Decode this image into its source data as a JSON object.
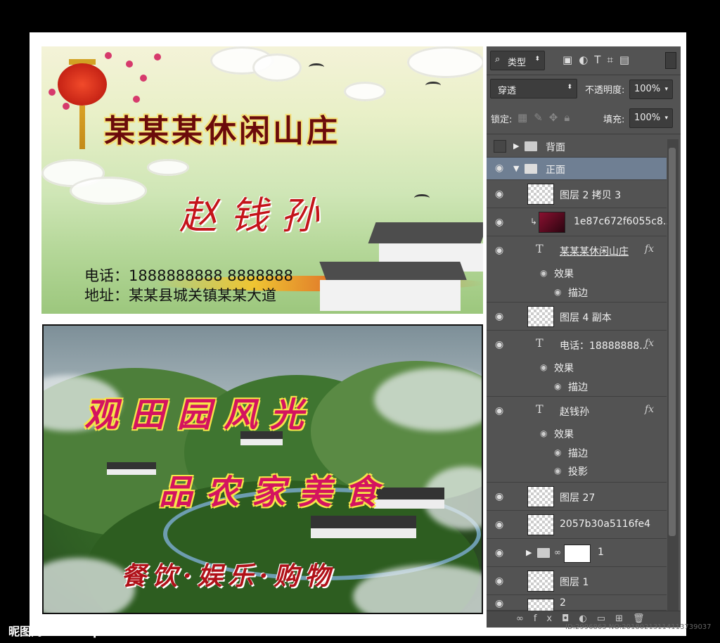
{
  "front_card": {
    "title": "某某某休闲山庄",
    "person_name": "赵钱孙",
    "phone_line": "电话：1888888888    8888888",
    "address_line": "地址：某某县城关镇某某大道"
  },
  "back_card": {
    "slogan_line1": "观田园风光",
    "slogan_line2": "品农家美食",
    "slogan_line3": "餐饮·娱乐·购物"
  },
  "layers_panel": {
    "filter_kind": "类型",
    "blend_mode": "穿透",
    "opacity_label": "不透明度:",
    "opacity_value": "100%",
    "lock_label": "锁定:",
    "fill_label": "填充:",
    "fill_value": "100%",
    "layers": [
      {
        "name": "背面",
        "type": "group",
        "visible": false,
        "expanded": false
      },
      {
        "name": "正面",
        "type": "group",
        "visible": true,
        "expanded": true,
        "selected": true
      },
      {
        "name": "图层 2 拷贝 3",
        "type": "pixel",
        "visible": true
      },
      {
        "name": "1e87c672f6055c8...",
        "type": "pixel-clipped",
        "visible": true
      },
      {
        "name": "某某某休闲山庄",
        "type": "text",
        "visible": true,
        "effects_label": "效果",
        "effects": [
          "描边"
        ]
      },
      {
        "name": "图层 4 副本",
        "type": "pixel",
        "visible": true
      },
      {
        "name": "电话：18888888...",
        "type": "text",
        "visible": true,
        "effects_label": "效果",
        "effects": [
          "描边"
        ]
      },
      {
        "name": "赵钱孙",
        "type": "text",
        "visible": true,
        "effects_label": "效果",
        "effects": [
          "描边",
          "投影"
        ]
      },
      {
        "name": "图层 27",
        "type": "pixel",
        "visible": true
      },
      {
        "name": "2057b30a5116fe4",
        "type": "pixel",
        "visible": true
      },
      {
        "name": "1",
        "type": "group-masked",
        "visible": true
      },
      {
        "name": "图层 1",
        "type": "pixel",
        "visible": true
      },
      {
        "name": "2",
        "type": "pixel",
        "visible": true
      }
    ]
  },
  "watermarks": {
    "left": "昵图网 www.nipic.com",
    "right": "ID:2996863 NO:20180213114113739037"
  },
  "icons": [
    "search-icon",
    "image-filter-icon",
    "adjustment-filter-icon",
    "text-filter-icon",
    "shape-filter-icon",
    "smart-object-filter-icon",
    "lock-transparency-icon",
    "lock-paint-icon",
    "lock-move-icon",
    "lock-all-icon",
    "eye-icon",
    "folder-icon",
    "link-icon",
    "fx-icon",
    "mask-icon",
    "new-group-icon",
    "new-layer-icon",
    "trash-icon"
  ]
}
